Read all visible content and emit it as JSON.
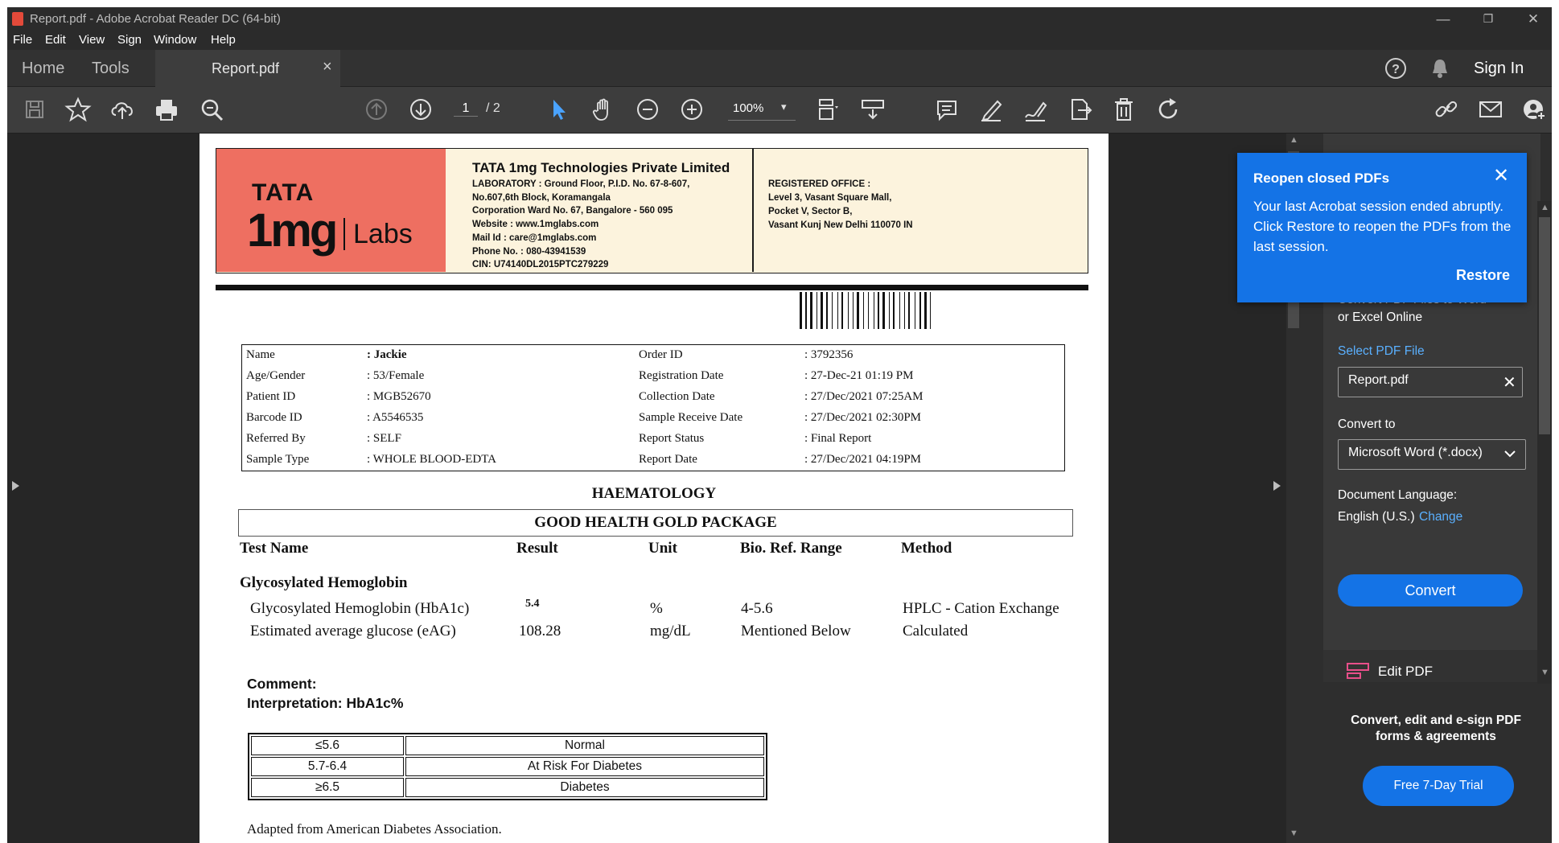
{
  "window": {
    "title": "Report.pdf - Adobe Acrobat Reader DC (64-bit)",
    "minimize": "—",
    "restore": "❐",
    "close": "✕"
  },
  "menu": [
    "File",
    "Edit",
    "View",
    "Sign",
    "Window",
    "Help"
  ],
  "tabs": {
    "home": "Home",
    "tools": "Tools",
    "document": "Report.pdf",
    "close": "×",
    "sign_in": "Sign In"
  },
  "toolbar": {
    "page_current": "1",
    "page_total": "/ 2",
    "zoom": "100%"
  },
  "report": {
    "company": "TATA 1mg Technologies Private Limited",
    "logo_tata": "TATA",
    "logo_1mg": "1mg",
    "logo_labs": "Labs",
    "lab_address": [
      "LABORATORY : Ground Floor, P.I.D. No. 67-8-607,",
      "No.607,6th Block, Koramangala",
      "Corporation Ward No. 67, Bangalore - 560 095",
      "Website : www.1mglabs.com",
      "Mail Id : care@1mglabs.com",
      "Phone No. : 080-43941539",
      "CIN: U74140DL2015PTC279229"
    ],
    "reg_office": [
      "REGISTERED OFFICE :",
      "Level 3, Vasant Square Mall,",
      "Pocket V, Sector B,",
      "Vasant Kunj New Delhi 110070 IN"
    ],
    "patient": [
      {
        "label": "Name",
        "value": ": Jackie",
        "label2": "Order ID",
        "value2": ": 3792356"
      },
      {
        "label": "Age/Gender",
        "value": ": 53/Female",
        "label2": "Registration Date",
        "value2": ": 27-Dec-21 01:19 PM"
      },
      {
        "label": "Patient ID",
        "value": ": MGB52670",
        "label2": "Collection Date",
        "value2": ": 27/Dec/2021 07:25AM"
      },
      {
        "label": "Barcode ID",
        "value": ": A5546535",
        "label2": "Sample Receive Date",
        "value2": ": 27/Dec/2021 02:30PM"
      },
      {
        "label": "Referred By",
        "value": ": SELF",
        "label2": "Report Status",
        "value2": ": Final Report"
      },
      {
        "label": "Sample Type",
        "value": ": WHOLE BLOOD-EDTA",
        "label2": "Report Date",
        "value2": ": 27/Dec/2021 04:19PM"
      }
    ],
    "department": "HAEMATOLOGY",
    "package": "GOOD HEALTH GOLD PACKAGE",
    "columns": [
      "Test Name",
      "Result",
      "Unit",
      "Bio. Ref. Range",
      "Method"
    ],
    "group": "Glycosylated Hemoglobin",
    "tests": [
      {
        "name": "Glycosylated Hemoglobin (HbA1c)",
        "result": "5.4",
        "unit": "%",
        "range": "4-5.6",
        "method": "HPLC - Cation Exchange"
      },
      {
        "name": "Estimated average glucose (eAG)",
        "result": "108.28",
        "unit": "mg/dL",
        "range": "Mentioned Below",
        "method": "Calculated"
      }
    ],
    "comment_label": "Comment:",
    "interpretation": "Interpretation: HbA1c%",
    "interp_table": [
      {
        "range": "≤5.6",
        "meaning": "Normal"
      },
      {
        "range": "5.7-6.4",
        "meaning": "At Risk For Diabetes"
      },
      {
        "range": "≥6.5",
        "meaning": "Diabetes"
      }
    ],
    "source": "Adapted from American Diabetes Association."
  },
  "toast": {
    "title": "Reopen closed PDFs",
    "message": "Your last Acrobat session ended abruptly. Click Restore to reopen the PDFs from the last session.",
    "restore": "Restore",
    "close": "✕"
  },
  "panel": {
    "intro_partial": "Convert PDF Files to Word",
    "intro_line2": "or Excel Online",
    "select_label": "Select PDF File",
    "file_value": "Report.pdf",
    "convert_to_label": "Convert to",
    "convert_to_value": "Microsoft Word (*.docx)",
    "lang_label": "Document Language:",
    "lang_value": "English (U.S.)",
    "lang_change": "Change",
    "convert_button": "Convert",
    "edit_pdf": "Edit PDF",
    "promo": "Convert, edit and e-sign PDF forms & agreements",
    "trial_button": "Free 7-Day Trial"
  },
  "colors": {
    "accent": "#1473e6",
    "logo_bg": "#ee6f61",
    "header_bg": "#fcf3dd",
    "chrome_dark": "#2b2b2b"
  }
}
